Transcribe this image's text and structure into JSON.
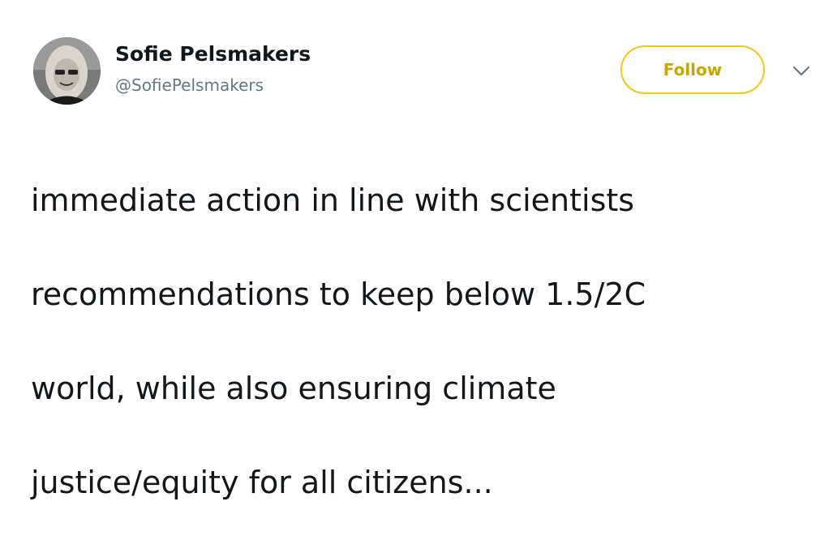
{
  "author": {
    "name": "Sofie Pelsmakers",
    "handle": "@SofiePelsmakers",
    "avatar_icon": "profile-photo"
  },
  "actions": {
    "follow_label": "Follow",
    "menu_icon": "chevron-down-icon"
  },
  "tweet": {
    "text_lines": [
      "immediate action in line with scientists",
      "recommendations to keep below 1.5/2C",
      "world, while also ensuring climate",
      "justice/equity for all citizens..."
    ]
  },
  "colors": {
    "follow_border": "#f5c518",
    "follow_text": "#c8a600",
    "handle": "#657786",
    "text": "#14171a"
  }
}
